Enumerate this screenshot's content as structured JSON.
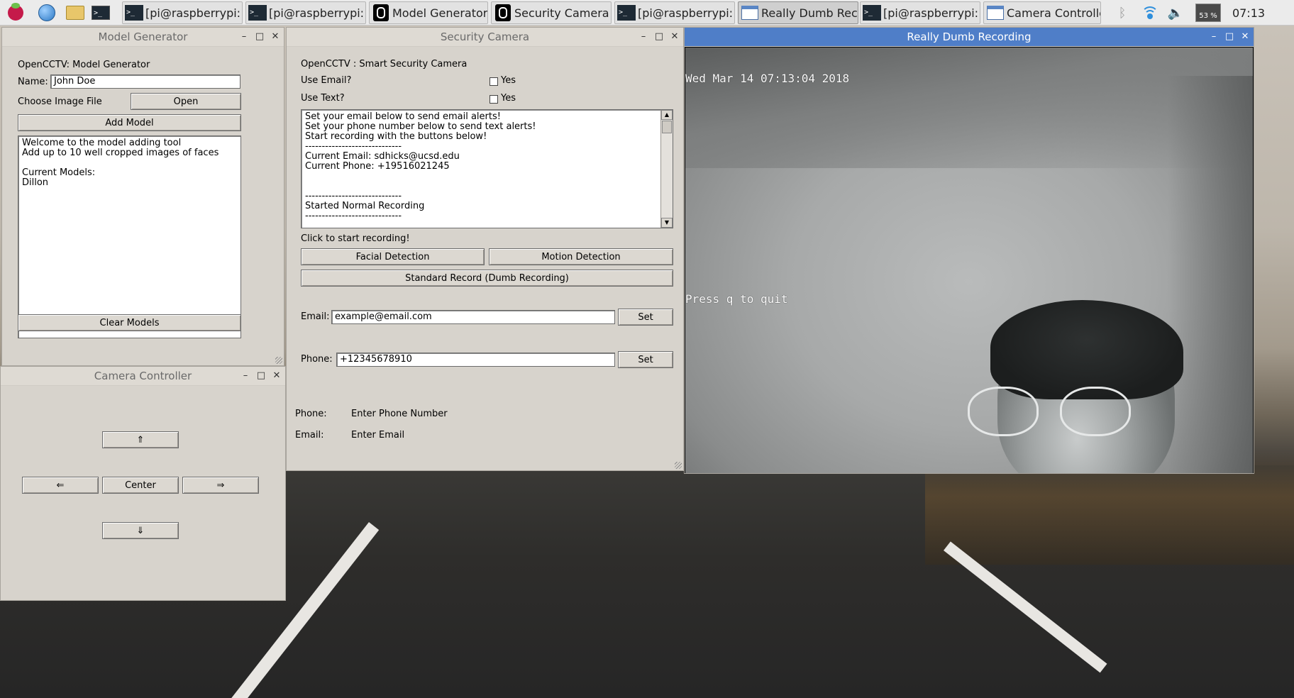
{
  "taskbar": {
    "tasks": [
      {
        "label": "[pi@raspberrypi: ..."
      },
      {
        "label": "[pi@raspberrypi: ..."
      },
      {
        "label": "Model Generator"
      },
      {
        "label": "Security Camera"
      },
      {
        "label": "[pi@raspberrypi: ~]"
      },
      {
        "label": "Really Dumb Rec..."
      },
      {
        "label": "[pi@raspberrypi: ..."
      },
      {
        "label": "Camera Controller"
      }
    ],
    "cpu_label": "53 %",
    "clock": "07:13"
  },
  "model_generator": {
    "title": "Model Generator",
    "heading": "OpenCCTV: Model Generator",
    "name_label": "Name:",
    "name_value": "John Doe",
    "choose_label": "Choose Image File",
    "open_button": "Open",
    "add_button": "Add Model",
    "output_text": "Welcome to the model adding tool\nAdd up to 10 well cropped images of faces\n\nCurrent Models:\nDillon",
    "clear_button": "Clear Models"
  },
  "camera_controller": {
    "title": "Camera Controller",
    "up_button": "⇑",
    "left_button": "⇐",
    "center_button": "Center",
    "right_button": "⇒",
    "down_button": "⇓"
  },
  "security_camera": {
    "title": "Security Camera",
    "heading": "OpenCCTV : Smart Security Camera",
    "use_email_label": "Use Email?",
    "use_email_option": "Yes",
    "use_text_label": "Use Text?",
    "use_text_option": "Yes",
    "log_text": "Set your email below to send email alerts!\nSet your phone number below to send text alerts!\nStart recording with the buttons below!\n-----------------------------\nCurrent Email: sdhicks@ucsd.edu\nCurrent Phone: +19516021245\n\n\n-----------------------------\nStarted Normal Recording\n-----------------------------",
    "click_label": "Click to start recording!",
    "facial_button": "Facial Detection",
    "motion_button": "Motion Detection",
    "standard_button": "Standard Record (Dumb Recording)",
    "email_label": "Email:",
    "email_value": "example@email.com",
    "email_set": "Set",
    "phone_label": "Phone:",
    "phone_value": "+12345678910",
    "phone_set": "Set",
    "status_phone_label": "Phone:",
    "status_phone_value": "Enter Phone Number",
    "status_email_label": "Email:",
    "status_email_value": "Enter Email"
  },
  "recording": {
    "title": "Really Dumb Recording",
    "timestamp": "Wed Mar 14 07:13:04 2018",
    "quit_hint": "Press q to quit"
  },
  "window_controls": {
    "minimize": "–",
    "maximize": "□",
    "close": "✕"
  }
}
